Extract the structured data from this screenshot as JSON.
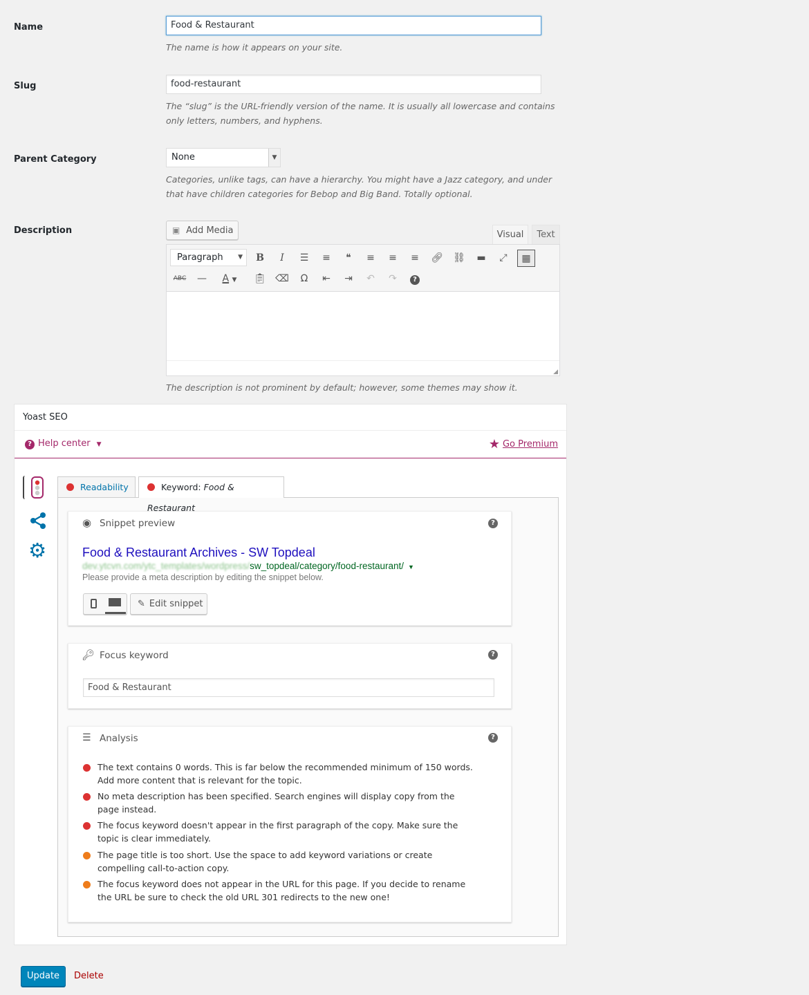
{
  "fields": {
    "name": {
      "label": "Name",
      "value": "Food & Restaurant",
      "help": "The name is how it appears on your site."
    },
    "slug": {
      "label": "Slug",
      "value": "food-restaurant",
      "help": "The “slug” is the URL-friendly version of the name. It is usually all lowercase and contains only letters, numbers, and hyphens."
    },
    "parent": {
      "label": "Parent Category",
      "value": "None",
      "help": "Categories, unlike tags, can have a hierarchy. You might have a Jazz category, and under that have children categories for Bebop and Big Band. Totally optional."
    },
    "description": {
      "label": "Description",
      "help": "The description is not prominent by default; however, some themes may show it."
    }
  },
  "editor": {
    "add_media": "Add Media",
    "tab_visual": "Visual",
    "tab_text": "Text",
    "format_select": "Paragraph",
    "row1_icons": [
      "bold-icon",
      "italic-icon",
      "bullet-list-icon",
      "numbered-list-icon",
      "blockquote-icon",
      "align-left-icon",
      "align-center-icon",
      "align-right-icon",
      "link-icon",
      "unlink-icon",
      "read-more-icon",
      "fullscreen-icon",
      "toolbar-toggle-icon"
    ],
    "row2_icons": [
      "strikethrough-icon",
      "horizontal-line-icon",
      "text-color-icon",
      "paste-text-icon",
      "clear-formatting-icon",
      "special-character-icon",
      "outdent-icon",
      "indent-icon",
      "undo-icon",
      "redo-icon",
      "help-icon"
    ]
  },
  "yoast": {
    "title": "Yoast SEO",
    "help_center": "Help center",
    "go_premium": "Go Premium",
    "tab_readability": "Readability",
    "tab_keyword_prefix": "Keyword:",
    "tab_keyword_value": "Food & Restaurant",
    "snippet": {
      "heading": "Snippet preview",
      "title": "Food & Restaurant Archives - SW Topdeal",
      "url_blurred": "dev.ytcvn.com/ytc_templates/wordpress/",
      "url": "sw_topdeal/category/food-restaurant/",
      "meta": "Please provide a meta description by editing the snippet below.",
      "edit_button": "Edit snippet"
    },
    "focus": {
      "heading": "Focus keyword",
      "value": "Food & Restaurant"
    },
    "analysis": {
      "heading": "Analysis",
      "items": [
        {
          "status": "bad",
          "color": "#dc3232",
          "text": "The text contains 0 words. This is far below the recommended minimum of 150 words. Add more content that is relevant for the topic."
        },
        {
          "status": "bad",
          "color": "#dc3232",
          "text": "No meta description has been specified. Search engines will display copy from the page instead."
        },
        {
          "status": "bad",
          "color": "#dc3232",
          "text": "The focus keyword doesn't appear in the first paragraph of the copy. Make sure the topic is clear immediately."
        },
        {
          "status": "ok",
          "color": "#ee7c1b",
          "text": "The page title is too short. Use the space to add keyword variations or create compelling call-to-action copy."
        },
        {
          "status": "ok",
          "color": "#ee7c1b",
          "text": "The focus keyword does not appear in the URL for this page. If you decide to rename the URL be sure to check the old URL 301 redirects to the new one!"
        }
      ]
    }
  },
  "actions": {
    "update": "Update",
    "delete": "Delete"
  },
  "colors": {
    "accent": "#a4286a",
    "primary": "#0085ba",
    "link": "#0073aa",
    "bad": "#dc3232",
    "ok": "#ee7c1b",
    "snippet_title": "#1e0fbe",
    "snippet_url": "#006621"
  }
}
